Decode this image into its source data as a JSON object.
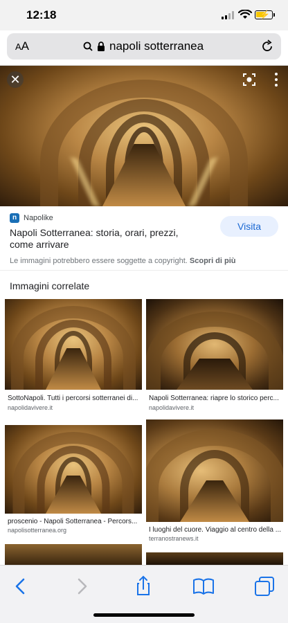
{
  "status": {
    "time": "12:18"
  },
  "browser": {
    "text_size_label": "AA",
    "address": "napoli sotterranea"
  },
  "detail": {
    "source_name": "Napolike",
    "source_logo_letter": "n",
    "title": "Napoli Sotterranea: storia, orari, prezzi, come arrivare",
    "visit_label": "Visita",
    "copyright_text": "Le immagini potrebbero essere soggette a copyright.",
    "learn_more": "Scopri di più"
  },
  "related": {
    "heading": "Immagini correlate",
    "items": [
      {
        "caption": "SottoNapoli. Tutti i percorsi sotterranei di...",
        "domain": "napolidavivere.it"
      },
      {
        "caption": "Napoli Sotterranea: riapre lo storico perc...",
        "domain": "napolidavivere.it"
      },
      {
        "caption": "proscenio - Napoli Sotterranea - Percors...",
        "domain": "napolisotterranea.org"
      },
      {
        "caption": "I luoghi del cuore. Viaggio al centro della ...",
        "domain": "terranostranews.it"
      }
    ]
  },
  "colors": {
    "accent": "#1967d2",
    "visit_bg": "#e8f0fe",
    "tunnel_light": "#e9c37c",
    "tunnel_dark": "#2e1c0b"
  },
  "icons": [
    "close-icon",
    "lens-icon",
    "more-icon",
    "search-icon",
    "lock-icon",
    "reload-icon",
    "back-icon",
    "forward-icon",
    "share-icon",
    "bookmarks-icon",
    "tabs-icon"
  ]
}
